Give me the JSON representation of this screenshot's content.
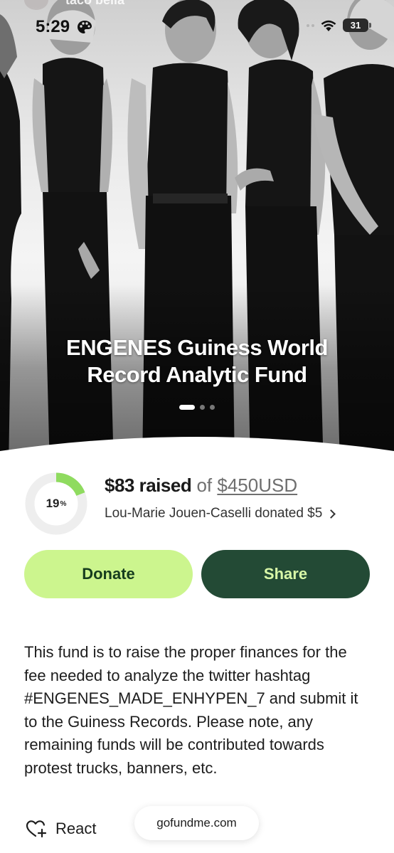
{
  "status_bar": {
    "time": "5:29",
    "battery": "31"
  },
  "story": {
    "username": "taco bella"
  },
  "campaign": {
    "title": "ENGENES Guiness World Record Analytic Fund",
    "carousel_total": 3,
    "carousel_active": 1
  },
  "progress": {
    "percent_value": 19,
    "percent_label": "19",
    "raised": "$83 raised",
    "of": "of",
    "goal": "$450USD",
    "recent_donation": "Lou-Marie Jouen-Caselli donated $5"
  },
  "buttons": {
    "donate": "Donate",
    "share": "Share"
  },
  "description": "This fund is to raise the proper finances for the fee needed to analyze the twitter hashtag #ENGENES_MADE_ENHYPEN_7 and submit it to the Guiness Records. Please note, any remaining funds will be contributed towards protest trucks, banners, etc.",
  "footer": {
    "react": "React",
    "domain": "gofundme.com"
  },
  "colors": {
    "accent_green": "#ccf58e",
    "dark_green": "#234a35",
    "ring_progress": "#8fdb5f",
    "ring_track": "#eeeeee"
  }
}
